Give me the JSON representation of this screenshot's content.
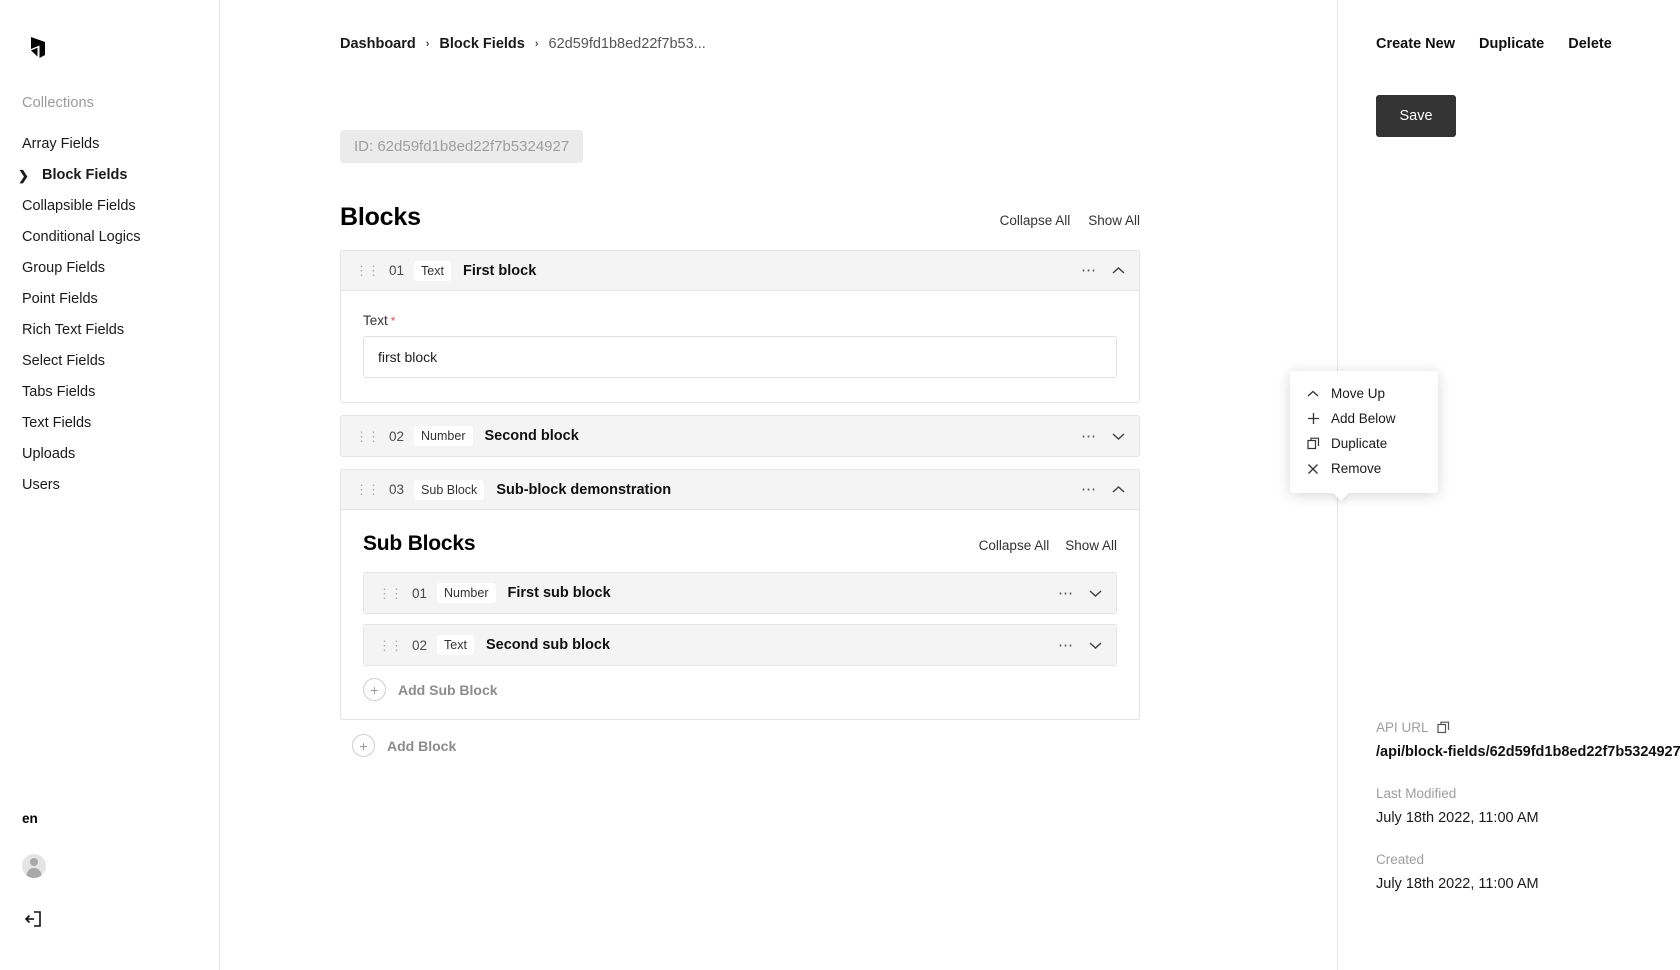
{
  "sidebar": {
    "logo_icon": "payload-logo-icon",
    "collections_label": "Collections",
    "items": [
      {
        "label": "Array Fields",
        "active": false
      },
      {
        "label": "Block Fields",
        "active": true
      },
      {
        "label": "Collapsible Fields",
        "active": false
      },
      {
        "label": "Conditional Logics",
        "active": false
      },
      {
        "label": "Group Fields",
        "active": false
      },
      {
        "label": "Point Fields",
        "active": false
      },
      {
        "label": "Rich Text Fields",
        "active": false
      },
      {
        "label": "Select Fields",
        "active": false
      },
      {
        "label": "Tabs Fields",
        "active": false
      },
      {
        "label": "Text Fields",
        "active": false
      },
      {
        "label": "Uploads",
        "active": false
      },
      {
        "label": "Users",
        "active": false
      }
    ],
    "locale": "en",
    "avatar_icon": "user-avatar-icon",
    "logout_icon": "logout-icon"
  },
  "breadcrumb": {
    "items": [
      "Dashboard",
      "Block Fields"
    ],
    "current": "62d59fd1b8ed22f7b53...",
    "separator": "›"
  },
  "document": {
    "id_prefix": "ID:",
    "id_value": "62d59fd1b8ed22f7b5324927",
    "blocks_section": {
      "title": "Blocks",
      "collapse_all": "Collapse All",
      "show_all": "Show All"
    },
    "blocks": [
      {
        "number": "01",
        "type": "Text",
        "label": "First block",
        "expanded": true,
        "field_label": "Text",
        "field_required": "*",
        "field_value": "first block"
      },
      {
        "number": "02",
        "type": "Number",
        "label": "Second block",
        "expanded": false
      },
      {
        "number": "03",
        "type": "Sub Block",
        "label": "Sub-block demonstration",
        "expanded": true
      }
    ],
    "sub_section": {
      "title": "Sub Blocks",
      "collapse_all": "Collapse All",
      "show_all": "Show All",
      "add_label": "Add Sub Block",
      "sub_blocks": [
        {
          "number": "01",
          "type": "Number",
          "label": "First sub block"
        },
        {
          "number": "02",
          "type": "Text",
          "label": "Second sub block"
        }
      ]
    },
    "add_block_label": "Add Block"
  },
  "popup": {
    "items": [
      {
        "label": "Move Up",
        "icon": "chevron-up-icon"
      },
      {
        "label": "Add Below",
        "icon": "plus-icon"
      },
      {
        "label": "Duplicate",
        "icon": "duplicate-icon"
      },
      {
        "label": "Remove",
        "icon": "close-icon"
      }
    ]
  },
  "rightbar": {
    "actions": [
      "Create New",
      "Duplicate",
      "Delete"
    ],
    "save_label": "Save",
    "api_url_key": "API URL",
    "api_url_value": "/api/block-fields/62d59fd1b8ed22f7b5324927",
    "last_modified_key": "Last Modified",
    "last_modified_value": "July 18th 2022, 11:00 AM",
    "created_key": "Created",
    "created_value": "July 18th 2022, 11:00 AM",
    "copy_icon": "copy-icon"
  },
  "colors": {
    "accent": "#333333",
    "required": "#e25050",
    "block_header_bg": "#f4f4f4",
    "border": "#e4e4e4"
  }
}
